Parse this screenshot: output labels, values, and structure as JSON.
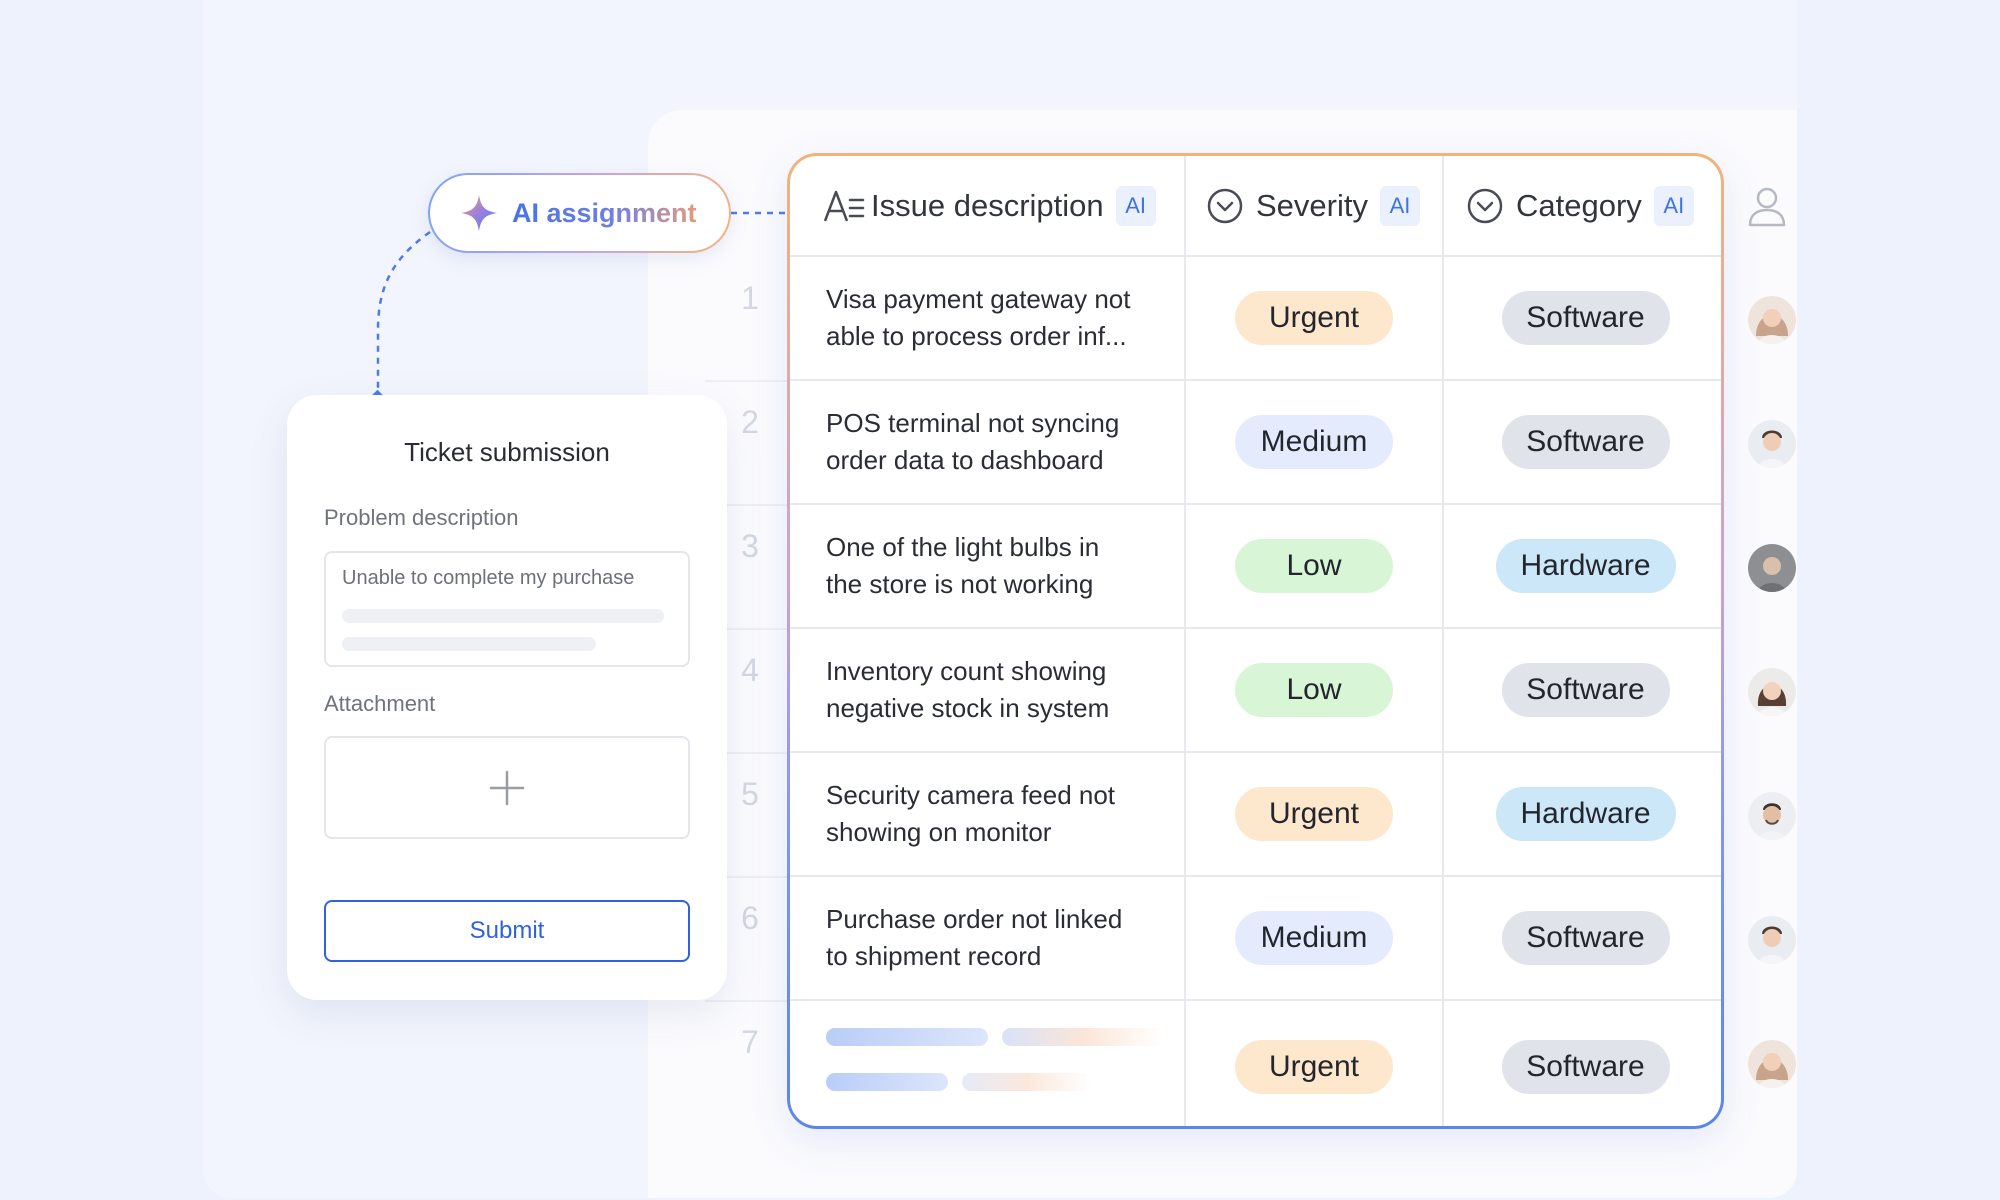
{
  "ai_pill": {
    "label": "AI assignment",
    "icon": "sparkle-icon"
  },
  "ticket": {
    "title": "Ticket submission",
    "problem_label": "Problem description",
    "problem_value": "Unable to complete my purchase",
    "attachment_label": "Attachment",
    "attachment_icon": "plus-icon",
    "submit_label": "Submit"
  },
  "table": {
    "headers": [
      {
        "label": "Issue description",
        "icon": "text-format-icon",
        "badge": "AI"
      },
      {
        "label": "Severity",
        "icon": "chevron-circle-icon",
        "badge": "AI"
      },
      {
        "label": "Category",
        "icon": "chevron-circle-icon",
        "badge": "AI"
      }
    ],
    "assignee_icon": "person-icon",
    "rows": [
      {
        "num": "1",
        "desc1": "Visa payment gateway not",
        "desc2": "able to process order inf...",
        "severity": "Urgent",
        "category": "Software"
      },
      {
        "num": "2",
        "desc1": "POS terminal not syncing",
        "desc2": "order data to dashboard",
        "severity": "Medium",
        "category": "Software"
      },
      {
        "num": "3",
        "desc1": "One of the light bulbs in",
        "desc2": "the store is not working",
        "severity": "Low",
        "category": "Hardware"
      },
      {
        "num": "4",
        "desc1": "Inventory count showing",
        "desc2": "negative stock in system",
        "severity": "Low",
        "category": "Software"
      },
      {
        "num": "5",
        "desc1": "Security camera feed not",
        "desc2": "showing on monitor",
        "severity": "Urgent",
        "category": "Hardware"
      },
      {
        "num": "6",
        "desc1": "Purchase order not linked",
        "desc2": "to shipment record",
        "severity": "Medium",
        "category": "Software"
      },
      {
        "num": "7",
        "desc1": "",
        "desc2": "",
        "severity": "Urgent",
        "category": "Software"
      }
    ]
  },
  "colors": {
    "accent": "#2f63dd",
    "urgent": "#fde7cd",
    "medium": "#e3ebfd",
    "low": "#d8f5d5",
    "software": "#e0e3e9",
    "hardware": "#cbe7f8"
  }
}
